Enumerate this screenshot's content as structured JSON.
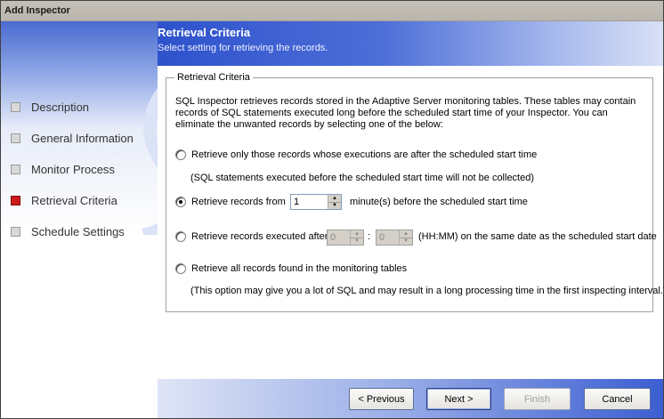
{
  "window": {
    "title": "Add Inspector"
  },
  "header": {
    "title": "Retrieval Criteria",
    "subtitle": "Select setting for retrieving the records."
  },
  "nav": {
    "items": [
      {
        "label": "Description",
        "active": false
      },
      {
        "label": "General Information",
        "active": false
      },
      {
        "label": "Monitor Process",
        "active": false
      },
      {
        "label": "Retrieval Criteria",
        "active": true
      },
      {
        "label": "Schedule Settings",
        "active": false
      }
    ]
  },
  "group": {
    "legend": "Retrieval Criteria",
    "description": "SQL Inspector retrieves records stored in the Adaptive Server monitoring tables. These tables may contain records of SQL statements executed long before the scheduled start time of your Inspector. You can eliminate the unwanted records by selecting one of the below:"
  },
  "options": {
    "after_start": {
      "label": "Retrieve only those records whose executions are after the scheduled start time",
      "note": "(SQL statements executed before the scheduled start time will not be collected)"
    },
    "minutes_before": {
      "label": "Retrieve records from",
      "value": "1",
      "suffix": "minute(s) before the scheduled start time"
    },
    "executed_after": {
      "label": "Retrieve records executed after",
      "hours": "0",
      "separator": ":",
      "minutes": "0",
      "suffix": "(HH:MM) on the same date as the scheduled start date"
    },
    "all_records": {
      "label": "Retrieve all records found in the monitoring tables",
      "note": "(This option may give you a lot of SQL and may result in a long processing time in the first inspecting interval.)"
    },
    "selected": "minutes_before"
  },
  "buttons": {
    "previous": "< Previous",
    "next": "Next >",
    "finish": "Finish",
    "cancel": "Cancel"
  },
  "colors": {
    "active_step": "#cc1a1a",
    "header_blue": "#2e52cc"
  }
}
